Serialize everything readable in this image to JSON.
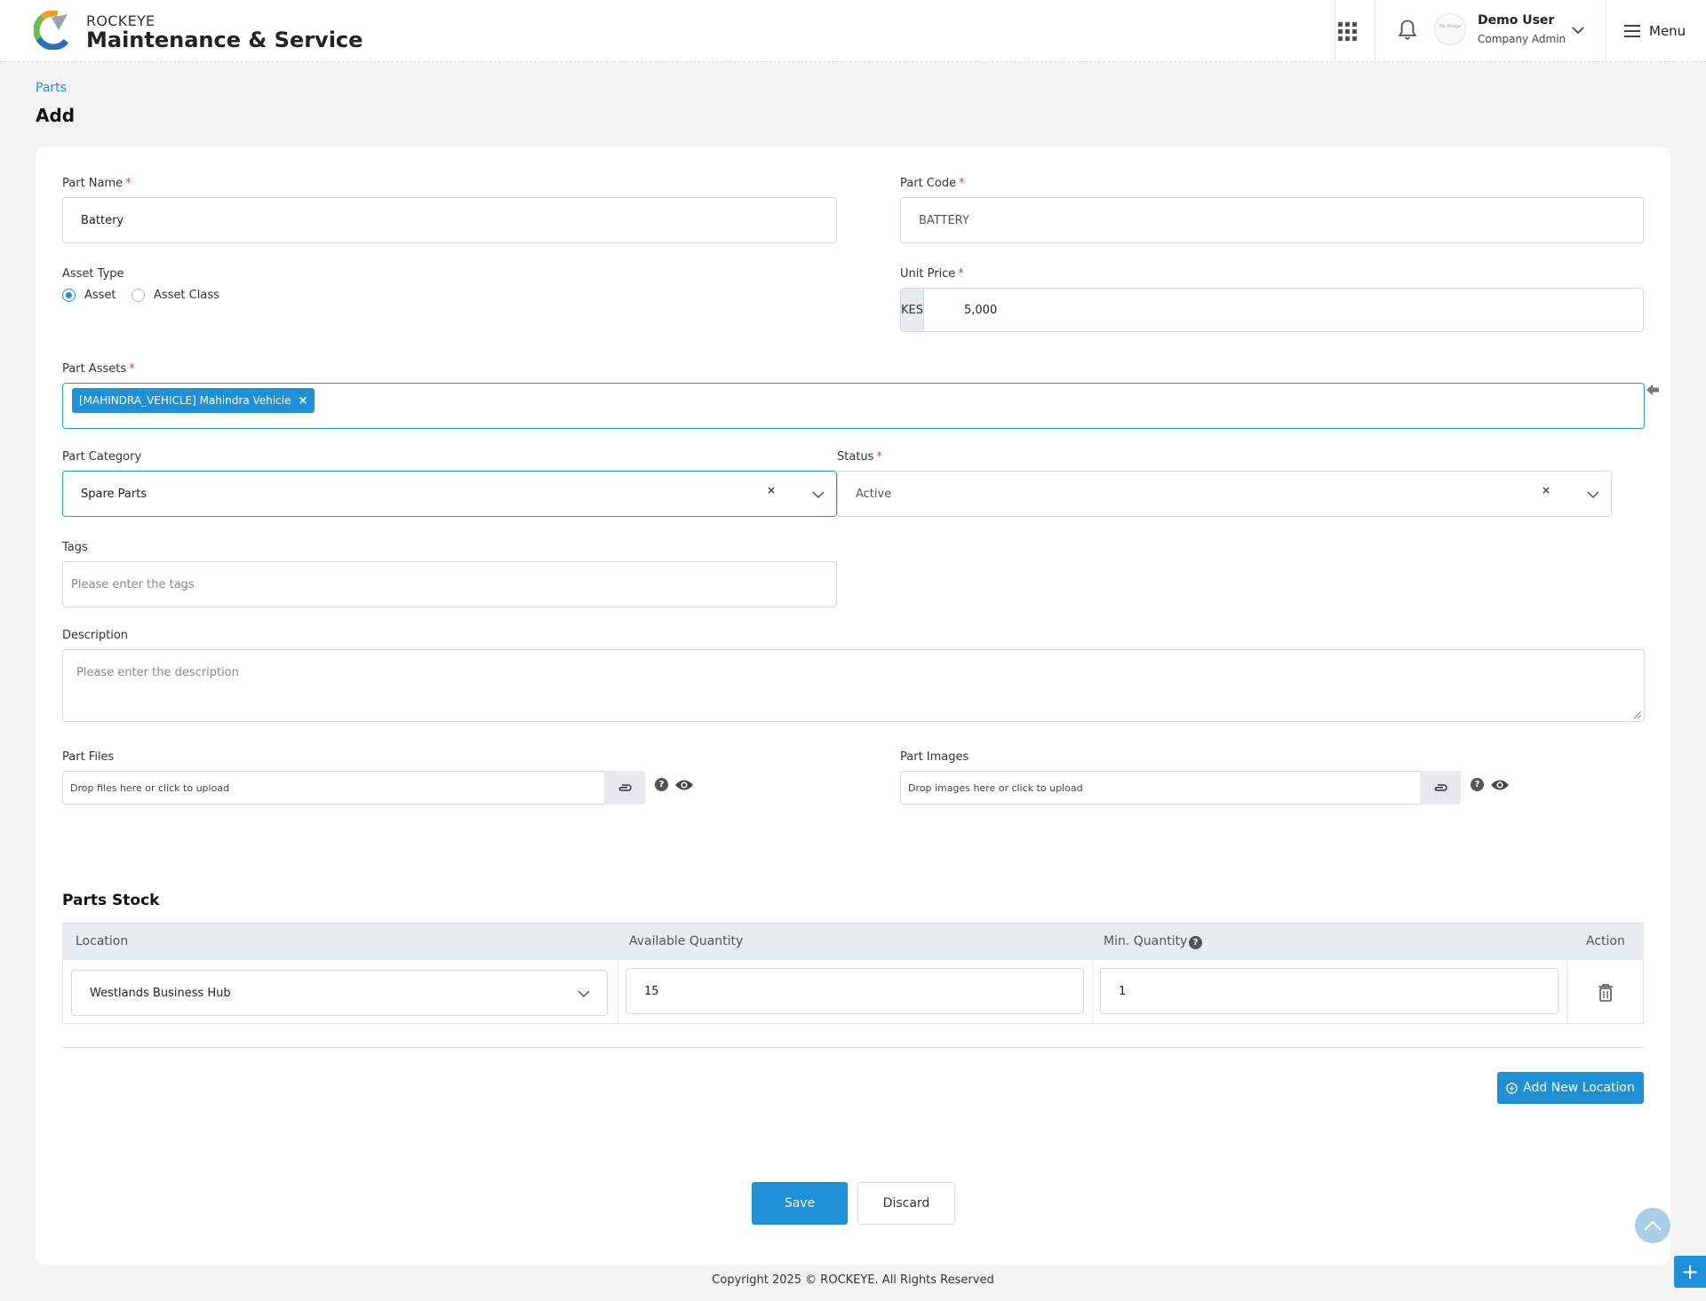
{
  "header": {
    "brand_small": "ROCKEYE",
    "brand_big": "Maintenance & Service",
    "avatar_text": "No Image",
    "user_name": "Demo User",
    "user_role": "Company Admin",
    "menu_label": "Menu",
    "icons": [
      "logo-icon",
      "apps-grid-icon",
      "bell-icon",
      "chevron-down-icon",
      "hamburger-icon"
    ]
  },
  "breadcrumb": "Parts",
  "page_title": "Add",
  "form": {
    "part_name": {
      "label": "Part Name",
      "value": "Battery"
    },
    "part_code": {
      "label": "Part Code",
      "value": "BATTERY"
    },
    "asset_type": {
      "label": "Asset Type",
      "options": [
        "Asset",
        "Asset Class"
      ],
      "selected": "Asset"
    },
    "unit_price": {
      "label": "Unit Price",
      "currency": "KES",
      "value": "5,000"
    },
    "part_assets": {
      "label": "Part Assets",
      "chips": [
        "[MAHINDRA_VEHICLE] Mahindra Vehicle"
      ],
      "chip_remove": "×"
    },
    "part_category": {
      "label": "Part Category",
      "value": "Spare Parts",
      "clear": "×"
    },
    "status": {
      "label": "Status",
      "value": "Active",
      "clear": "×"
    },
    "tags": {
      "label": "Tags",
      "placeholder": "Please enter the tags"
    },
    "description": {
      "label": "Description",
      "placeholder": "Please enter the description"
    },
    "part_files": {
      "label": "Part Files",
      "placeholder": "Drop files here or click to upload"
    },
    "part_images": {
      "label": "Part Images",
      "placeholder": "Drop images here or click to upload"
    },
    "help_glyph": "?",
    "required_mark": "*"
  },
  "parts_stock": {
    "title": "Parts Stock",
    "columns": [
      "Location",
      "Available Quantity",
      "Min. Quantity",
      "Action"
    ],
    "rows": [
      {
        "location": "Westlands Business Hub",
        "available_quantity": "15",
        "min_quantity": "1"
      }
    ],
    "add_button": "Add New Location"
  },
  "actions": {
    "save": "Save",
    "discard": "Discard"
  },
  "fab_label": "+",
  "footer": "Copyright 2025 © ROCKEYE. All Rights Reserved",
  "colors": {
    "primary": "#1e90d8",
    "focus_border": "#20a8a0",
    "required": "#e04040",
    "link": "#2a8fd0"
  }
}
